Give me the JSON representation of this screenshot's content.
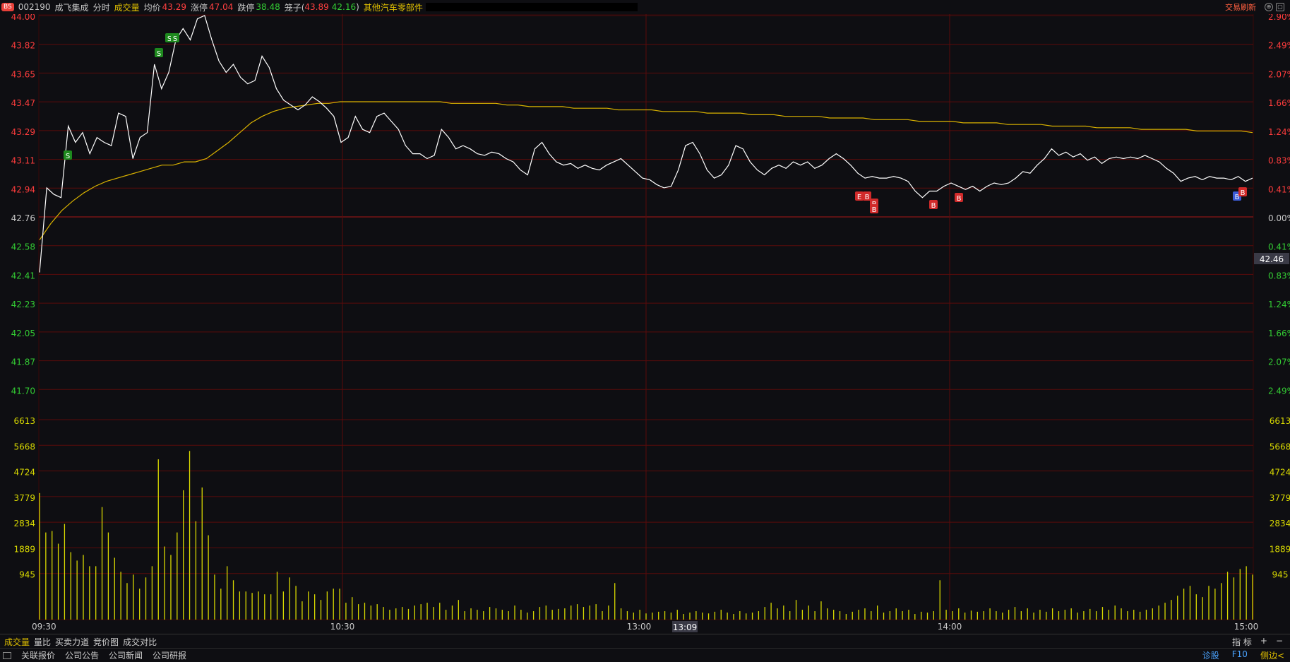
{
  "header": {
    "badge": "BS",
    "code": "002190",
    "name": "成飞集成",
    "mode": "分时",
    "volume_label": "成交量",
    "avg_label": "均价",
    "avg_value": "43.29",
    "limit_up_label": "涨停",
    "limit_up_value": "47.04",
    "limit_down_label": "跌停",
    "limit_down_value": "38.48",
    "cage_label": "笼子(",
    "cage_high": "43.89",
    "cage_low": "42.16",
    "cage_close": ")",
    "sector": "其他汽车零部件",
    "trade_refresh": "交易刷新"
  },
  "colors": {
    "up": "#ff3c3c",
    "down": "#33cc33",
    "price_line": "#ffffff",
    "avg_line": "#d9b200",
    "volume": "#d9d900",
    "grid": "#5a0b0b"
  },
  "chart_data": {
    "type": "line",
    "price_axis": {
      "labels": [
        "44.00",
        "43.82",
        "43.65",
        "43.47",
        "43.29",
        "43.11",
        "42.94",
        "42.76",
        "42.58",
        "42.41",
        "42.23",
        "42.05",
        "41.87",
        "41.70"
      ],
      "pct_labels": [
        "2.90%",
        "2.49%",
        "2.07%",
        "1.66%",
        "1.24%",
        "0.83%",
        "0.41%",
        "0.00%",
        "0.41%",
        "0.83%",
        "1.24%",
        "1.66%",
        "2.07%",
        "2.49%"
      ],
      "prev_close": 42.76,
      "ylim": [
        41.7,
        44.0
      ]
    },
    "cursor_price": "42.46",
    "volume_axis": {
      "labels": [
        "6613",
        "5668",
        "4724",
        "3779",
        "2834",
        "1889",
        "945"
      ],
      "ylim": [
        0,
        6613
      ]
    },
    "time_labels": [
      "09:30",
      "10:30",
      "13:00",
      "14:00",
      "15:00"
    ],
    "cursor_time": "13:09",
    "price": [
      42.42,
      42.94,
      42.9,
      42.88,
      43.32,
      43.22,
      43.28,
      43.15,
      43.25,
      43.22,
      43.2,
      43.4,
      43.38,
      43.12,
      43.25,
      43.28,
      43.7,
      43.55,
      43.65,
      43.85,
      43.92,
      43.85,
      43.98,
      44.0,
      43.85,
      43.72,
      43.65,
      43.7,
      43.62,
      43.58,
      43.6,
      43.75,
      43.68,
      43.55,
      43.48,
      43.45,
      43.42,
      43.45,
      43.5,
      43.47,
      43.43,
      43.38,
      43.22,
      43.25,
      43.38,
      43.3,
      43.28,
      43.38,
      43.4,
      43.35,
      43.3,
      43.2,
      43.15,
      43.15,
      43.12,
      43.14,
      43.3,
      43.25,
      43.18,
      43.2,
      43.18,
      43.15,
      43.14,
      43.16,
      43.15,
      43.12,
      43.1,
      43.05,
      43.02,
      43.18,
      43.22,
      43.15,
      43.1,
      43.08,
      43.09,
      43.06,
      43.08,
      43.06,
      43.05,
      43.08,
      43.1,
      43.12,
      43.08,
      43.04,
      43.0,
      42.99,
      42.96,
      42.94,
      42.95,
      43.05,
      43.2,
      43.22,
      43.15,
      43.05,
      43.0,
      43.02,
      43.08,
      43.2,
      43.18,
      43.1,
      43.05,
      43.02,
      43.06,
      43.08,
      43.06,
      43.1,
      43.08,
      43.1,
      43.06,
      43.08,
      43.12,
      43.15,
      43.12,
      43.08,
      43.03,
      43.0,
      43.01,
      43.0,
      43.0,
      43.01,
      43.0,
      42.98,
      42.92,
      42.88,
      42.92,
      42.92,
      42.95,
      42.97,
      42.95,
      42.93,
      42.95,
      42.92,
      42.95,
      42.97,
      42.96,
      42.97,
      43.0,
      43.04,
      43.03,
      43.08,
      43.12,
      43.18,
      43.14,
      43.16,
      43.13,
      43.15,
      43.11,
      43.13,
      43.09,
      43.12,
      43.13,
      43.12,
      43.13,
      43.12,
      43.14,
      43.12,
      43.1,
      43.06,
      43.03,
      42.98,
      43.0,
      43.01,
      42.99,
      43.01,
      43.0,
      43.0,
      42.99,
      43.01,
      42.98,
      43.0
    ],
    "avg": [
      42.62,
      42.72,
      42.8,
      42.86,
      42.91,
      42.95,
      42.98,
      43.0,
      43.02,
      43.04,
      43.06,
      43.08,
      43.08,
      43.1,
      43.1,
      43.12,
      43.17,
      43.22,
      43.28,
      43.34,
      43.38,
      43.41,
      43.43,
      43.44,
      43.45,
      43.46,
      43.46,
      43.47,
      43.47,
      43.47,
      43.47,
      43.47,
      43.47,
      43.47,
      43.47,
      43.47,
      43.47,
      43.46,
      43.46,
      43.46,
      43.46,
      43.46,
      43.45,
      43.45,
      43.44,
      43.44,
      43.44,
      43.44,
      43.43,
      43.43,
      43.43,
      43.43,
      43.42,
      43.42,
      43.42,
      43.42,
      43.41,
      43.41,
      43.41,
      43.41,
      43.4,
      43.4,
      43.4,
      43.4,
      43.39,
      43.39,
      43.39,
      43.38,
      43.38,
      43.38,
      43.38,
      43.37,
      43.37,
      43.37,
      43.37,
      43.36,
      43.36,
      43.36,
      43.36,
      43.35,
      43.35,
      43.35,
      43.35,
      43.34,
      43.34,
      43.34,
      43.34,
      43.33,
      43.33,
      43.33,
      43.33,
      43.32,
      43.32,
      43.32,
      43.32,
      43.31,
      43.31,
      43.31,
      43.31,
      43.3,
      43.3,
      43.3,
      43.3,
      43.3,
      43.29,
      43.29,
      43.29,
      43.29,
      43.29,
      43.28
    ],
    "volume": [
      4500,
      3100,
      3150,
      2700,
      3400,
      2400,
      2100,
      2300,
      1900,
      1900,
      4000,
      3100,
      2200,
      1700,
      1300,
      1600,
      1100,
      1500,
      1900,
      5700,
      2600,
      2300,
      3100,
      4600,
      6000,
      3500,
      4700,
      3000,
      1600,
      1100,
      1900,
      1400,
      1000,
      1000,
      950,
      1000,
      900,
      900,
      1700,
      1000,
      1500,
      1200,
      650,
      1000,
      900,
      700,
      1000,
      1100,
      1100,
      600,
      800,
      550,
      600,
      500,
      550,
      450,
      350,
      400,
      450,
      380,
      500,
      550,
      600,
      450,
      600,
      350,
      500,
      700,
      300,
      400,
      350,
      300,
      450,
      400,
      350,
      300,
      500,
      350,
      250,
      300,
      450,
      500,
      350,
      380,
      400,
      500,
      550,
      450,
      500,
      550,
      300,
      500,
      1300,
      400,
      300,
      250,
      350,
      220,
      250,
      280,
      300,
      250,
      350,
      200,
      250,
      300,
      250,
      220,
      280,
      350,
      250,
      200,
      300,
      220,
      250,
      300,
      450,
      600,
      400,
      500,
      300,
      700,
      350,
      500,
      300,
      650,
      400,
      350,
      300,
      200,
      280,
      350,
      400,
      300,
      500,
      250,
      300,
      400,
      300,
      350,
      200,
      280,
      250,
      300,
      1400,
      350,
      300,
      400,
      250,
      320,
      280,
      300,
      400,
      300,
      250,
      350,
      450,
      300,
      400,
      250,
      350,
      280,
      400,
      300,
      350,
      400,
      250,
      300,
      380,
      300,
      450,
      350,
      500,
      400,
      300,
      350,
      280,
      350,
      400,
      500,
      600,
      700,
      850,
      1100,
      1200,
      900,
      800,
      1200,
      1100,
      1300,
      1700,
      1500,
      1800,
      1900,
      1600
    ]
  },
  "markers": [
    "S",
    "S",
    "S",
    "S",
    "E",
    "B",
    "B",
    "B",
    "B",
    "B",
    "B",
    "B"
  ],
  "tabs": [
    "成交量",
    "量比",
    "买卖力道",
    "竞价图",
    "成交对比"
  ],
  "tabs_right": [
    "指 标",
    "+",
    "−"
  ],
  "bottom_links": [
    "关联报价",
    "公司公告",
    "公司新闻",
    "公司研报"
  ],
  "bottom_right": [
    "诊股",
    "F10",
    "侧边<"
  ]
}
